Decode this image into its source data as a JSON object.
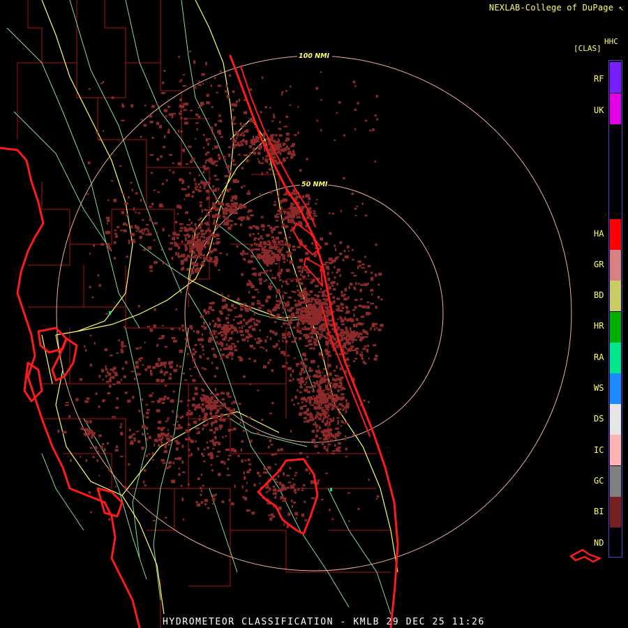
{
  "credit": "NEXLAB-College of DuPage",
  "credit_mark": "↖",
  "legend": {
    "product": "HHC",
    "code": "[CLAS]",
    "items": [
      {
        "label": "RF",
        "color": "#7a1eff"
      },
      {
        "label": "UK",
        "color": "#e600e6"
      },
      {
        "label": "HA",
        "color": "#ff0000"
      },
      {
        "label": "GR",
        "color": "#d98080"
      },
      {
        "label": "BD",
        "color": "#cccc66"
      },
      {
        "label": "HR",
        "color": "#00b000"
      },
      {
        "label": "RA",
        "color": "#00e68a"
      },
      {
        "label": "WS",
        "color": "#1e8cff"
      },
      {
        "label": "DS",
        "color": "#e6e6e6"
      },
      {
        "label": "IC",
        "color": "#ffb3b3"
      },
      {
        "label": "GC",
        "color": "#808080"
      },
      {
        "label": "BI",
        "color": "#7a1f1f"
      },
      {
        "label": "ND",
        "color": "#000000"
      }
    ]
  },
  "range_rings": [
    {
      "label": "100 NMI"
    },
    {
      "label": "50 NMI"
    }
  ],
  "footer": "HYDROMETEOR CLASSIFICATION - KMLB 29 DEC 25 11:26",
  "colors": {
    "background": "#000000",
    "coast": "#ff1a1a",
    "county": "#b01010",
    "highway_major": "#ffff66",
    "highway_minor": "#88dd99",
    "range_ring": "#f0b0a0",
    "biological": "#8b2a2a"
  }
}
